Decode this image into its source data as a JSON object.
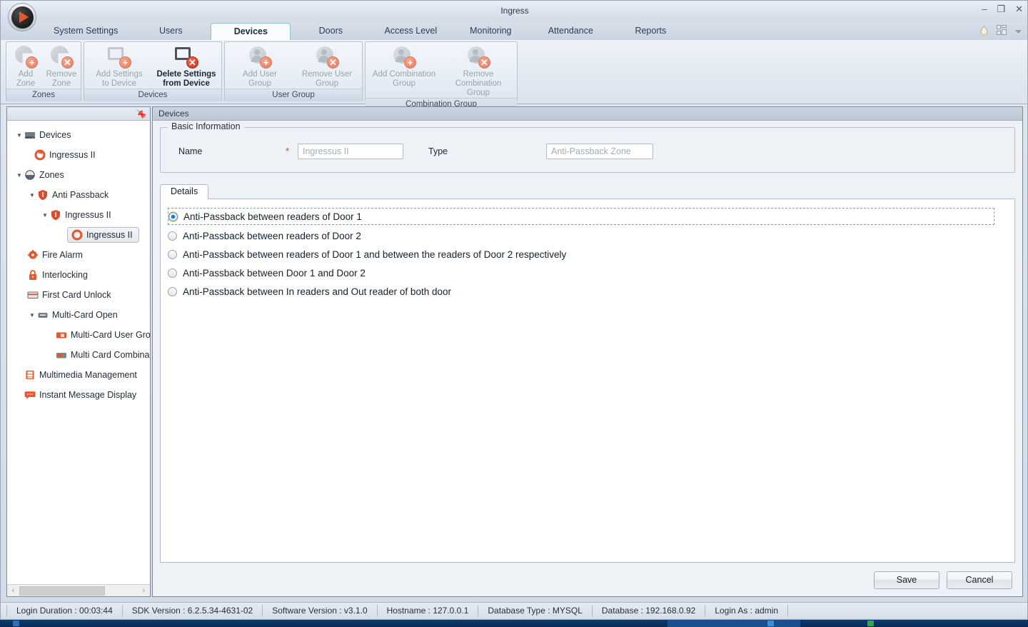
{
  "window": {
    "title": "Ingress",
    "controls": [
      {
        "name": "minimize",
        "glyph": "–"
      },
      {
        "name": "restore",
        "glyph": "❐"
      },
      {
        "name": "close",
        "glyph": "✕"
      }
    ]
  },
  "tabs": [
    {
      "label": "System Settings",
      "active": false
    },
    {
      "label": "Users",
      "active": false
    },
    {
      "label": "Devices",
      "active": true
    },
    {
      "label": "Doors",
      "active": false
    },
    {
      "label": "Access Level",
      "active": false
    },
    {
      "label": "Monitoring",
      "active": false
    },
    {
      "label": "Attendance",
      "active": false
    },
    {
      "label": "Reports",
      "active": false
    }
  ],
  "tabstrip_right": {
    "help_icon": "flame-icon",
    "layout_icon": "grid-icon",
    "chevron_icon": "chevron-down-icon"
  },
  "ribbon": {
    "groups": [
      {
        "title": "Zones",
        "items": [
          {
            "label": "Add\nZone",
            "icon": "add-zone-icon",
            "enabled": false
          },
          {
            "label": "Remove\nZone",
            "icon": "remove-zone-icon",
            "enabled": false
          }
        ]
      },
      {
        "title": "Devices",
        "items": [
          {
            "label": "Add Settings\nto Device",
            "icon": "add-settings-to-device-icon",
            "enabled": false
          },
          {
            "label": "Delete Settings\nfrom Device",
            "icon": "delete-settings-from-device-icon",
            "enabled": true
          }
        ]
      },
      {
        "title": "User Group",
        "items": [
          {
            "label": "Add User\nGroup",
            "icon": "add-user-group-icon",
            "enabled": false
          },
          {
            "label": "Remove User\nGroup",
            "icon": "remove-user-group-icon",
            "enabled": false
          }
        ]
      },
      {
        "title": "Combination Group",
        "items": [
          {
            "label": "Add Combination\nGroup",
            "icon": "add-combination-group-icon",
            "enabled": false
          },
          {
            "label": "Remove Combination\nGroup",
            "icon": "remove-combination-group-icon",
            "enabled": false
          }
        ]
      }
    ]
  },
  "sidebar": {
    "pin_icon": "pin-icon",
    "tree": [
      {
        "label": "Devices",
        "depth": 0,
        "arrow": "expanded",
        "icon": "device-icon",
        "selected": false
      },
      {
        "label": "Ingressus II",
        "depth": 1,
        "arrow": "none",
        "icon": "gear-icon",
        "selected": false
      },
      {
        "label": "Zones",
        "depth": 0,
        "arrow": "expanded",
        "icon": "zone-globe-icon",
        "selected": false
      },
      {
        "label": "Anti Passback",
        "depth": 1,
        "arrow": "expanded",
        "icon": "shield-icon",
        "selected": false
      },
      {
        "label": "Ingressus II",
        "depth": 2,
        "arrow": "expanded",
        "icon": "shield-icon",
        "selected": false
      },
      {
        "label": "Ingressus II",
        "depth": 3,
        "arrow": "none",
        "icon": "gear-icon",
        "selected": true
      },
      {
        "label": "Fire Alarm",
        "depth": 1,
        "arrow": "none",
        "icon": "fire-alarm-icon",
        "selected": false
      },
      {
        "label": "Interlocking",
        "depth": 1,
        "arrow": "none",
        "icon": "lock-icon",
        "selected": false
      },
      {
        "label": "First Card Unlock",
        "depth": 1,
        "arrow": "none",
        "icon": "card-icon",
        "selected": false
      },
      {
        "label": "Multi-Card Open",
        "depth": 1,
        "arrow": "expanded",
        "icon": "multicard-icon",
        "selected": false
      },
      {
        "label": "Multi-Card User Gro",
        "depth": 2,
        "arrow": "none",
        "icon": "multicard-user-group-icon",
        "selected": false
      },
      {
        "label": "Multi Card Combina",
        "depth": 2,
        "arrow": "none",
        "icon": "multicard-combination-icon",
        "selected": false
      },
      {
        "label": "Multimedia Management",
        "depth": 0,
        "arrow": "none",
        "icon": "film-icon",
        "selected": false
      },
      {
        "label": "Instant Message Display",
        "depth": 0,
        "arrow": "none",
        "icon": "message-icon",
        "selected": false
      }
    ],
    "scroll": {
      "left_arrow": "‹",
      "right_arrow": "›"
    }
  },
  "content": {
    "header": "Devices",
    "basic_information": {
      "legend": "Basic Information",
      "name_label": "Name",
      "name_required": "*",
      "name_value": "Ingressus II",
      "type_label": "Type",
      "type_value": "Anti-Passback Zone"
    },
    "details_tab": {
      "label": "Details",
      "options": [
        {
          "label": "Anti-Passback between readers of Door 1",
          "selected": true,
          "focused": true
        },
        {
          "label": "Anti-Passback between readers of Door 2",
          "selected": false,
          "focused": false
        },
        {
          "label": "Anti-Passback between readers of Door 1 and between the readers of Door 2 respectively",
          "selected": false,
          "focused": false
        },
        {
          "label": "Anti-Passback between Door 1 and Door 2",
          "selected": false,
          "focused": false
        },
        {
          "label": "Anti-Passback between In readers and Out reader of both door",
          "selected": false,
          "focused": false
        }
      ]
    },
    "buttons": {
      "save": "Save",
      "cancel": "Cancel"
    }
  },
  "statusbar": [
    "Login Duration : 00:03:44",
    "SDK Version : 6.2.5.34-4631-02",
    "Software Version : v3.1.0",
    "Hostname : 127.0.0.1",
    "Database Type : MYSQL",
    "Database : 192.168.0.92",
    "Login As : admin"
  ],
  "colors": {
    "accent_orange": "#e8562a",
    "required_red": "#d23b2a",
    "active_tab_border": "#8fc3d2",
    "selection_blue": "#1f7ad1"
  }
}
